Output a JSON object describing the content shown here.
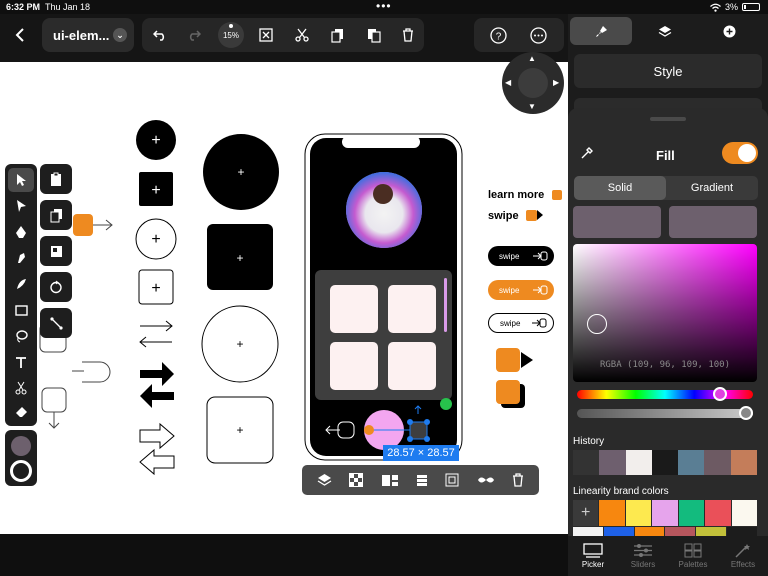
{
  "status": {
    "time": "6:32 PM",
    "date": "Thu Jan 18",
    "battery": "3%"
  },
  "toolbar": {
    "doc_name": "ui-elem...",
    "zoom": "15%"
  },
  "panel": {
    "style_label": "Style",
    "fill_label": "Fill",
    "fill_enabled": true,
    "segments": [
      "Solid",
      "Gradient"
    ],
    "selected_segment": "Solid",
    "rgba_readout": "RGBA (109, 96, 109, 100)",
    "current_color": "#6d606d",
    "history_label": "History",
    "history_colors": [
      "#333333",
      "#6e5f6e",
      "#f2eeec",
      "#1a1a1a",
      "#5a7e94",
      "#6d5a63",
      "#c47d5a"
    ],
    "brand_label": "Linearity brand colors",
    "brand_colors": [
      "#f7870f",
      "#fde94f",
      "#e6a4ec",
      "#13bb7e",
      "#ea5059",
      "#fbf8ef"
    ],
    "brand_colors_row2": [
      "#f3f3f3",
      "#1e61e8",
      "#f7870f",
      "#b6565d",
      "#c2c03a",
      "#1c1c1c"
    ],
    "bottom_tabs": [
      "Picker",
      "Sliders",
      "Palettes",
      "Effects"
    ],
    "active_tab": "Picker"
  },
  "canvas": {
    "learn_more": "learn more",
    "swipe_label": "swipe",
    "pill_label": "swipe",
    "dims": "28.57 × 28.57"
  },
  "colors": {
    "accent": "#ee8a20",
    "selection": "#1e7cf0",
    "panel": "#2a2a2a"
  }
}
